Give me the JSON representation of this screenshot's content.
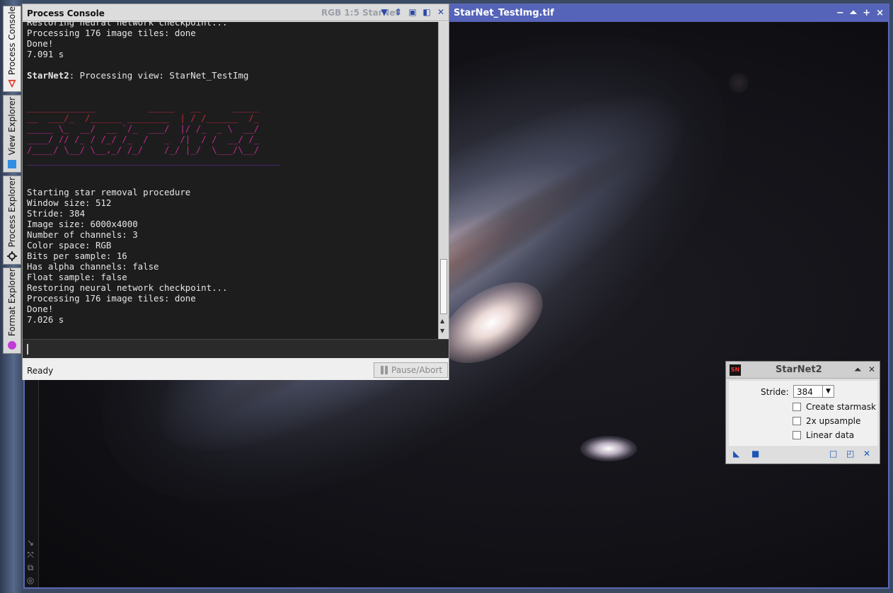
{
  "sidebar": {
    "tabs": [
      {
        "label": "Process Console",
        "icon": "process-console-icon",
        "active": true
      },
      {
        "label": "View Explorer",
        "icon": "view-explorer-icon",
        "active": false
      },
      {
        "label": "Process Explorer",
        "icon": "process-explorer-icon",
        "active": false
      },
      {
        "label": "Format Explorer",
        "icon": "format-explorer-icon",
        "active": false
      }
    ]
  },
  "image_window": {
    "title": "StarNet_TestImg.tif",
    "minimize": "−",
    "shade": "⏶",
    "maximize": "+",
    "close": "×",
    "tool_icons": [
      "zoom-arrow-icon",
      "fit-icon",
      "copy-icon",
      "target-icon"
    ]
  },
  "console": {
    "title": "Process Console",
    "underlying_title": "RGB 1:5 StarNet",
    "output_top": [
      "Restoring neural network checkpoint...",
      "Processing 176 image tiles: done",
      "Done!",
      "7.091 s"
    ],
    "processing_label": "StarNet2",
    "processing_text": ": Processing view: StarNet_TestImg",
    "ascii_art": [
      "_____________          _____   __      _____",
      "__  ___/_  /______ ________  | / /______  /_",
      "_____ \\_  __/  __ `/_  ___/  |/ /_  _ \\  __/",
      "____/ // /_ / /_/ /_  /   _  /|  / /  __/ /_",
      "/____/ \\__/ \\__,_/ /_/    /_/ |_/  \\___/\\__/",
      "________________________________________________"
    ],
    "output_bottom": [
      "Starting star removal procedure",
      "Window size: 512",
      "Stride: 384",
      "Image size: 6000x4000",
      "Number of channels: 3",
      "Color space: RGB",
      "Bits per sample: 16",
      "Has alpha channels: false",
      "Float sample: false",
      "Restoring neural network checkpoint...",
      "Processing 176 image tiles: done",
      "Done!",
      "7.026 s"
    ],
    "status": "Ready",
    "pause_button": "Pause/Abort"
  },
  "starnet_dialog": {
    "title": "StarNet2",
    "logo_text": "SN",
    "stride_label": "Stride:",
    "stride_value": "384",
    "options": [
      {
        "label": "Create starmask",
        "checked": false
      },
      {
        "label": "2x upsample",
        "checked": false
      },
      {
        "label": "Linear data",
        "checked": false
      }
    ],
    "footer_icons": [
      "new-instance-icon",
      "apply-icon",
      "browse-docs-icon",
      "preferences-icon",
      "reset-icon"
    ]
  }
}
